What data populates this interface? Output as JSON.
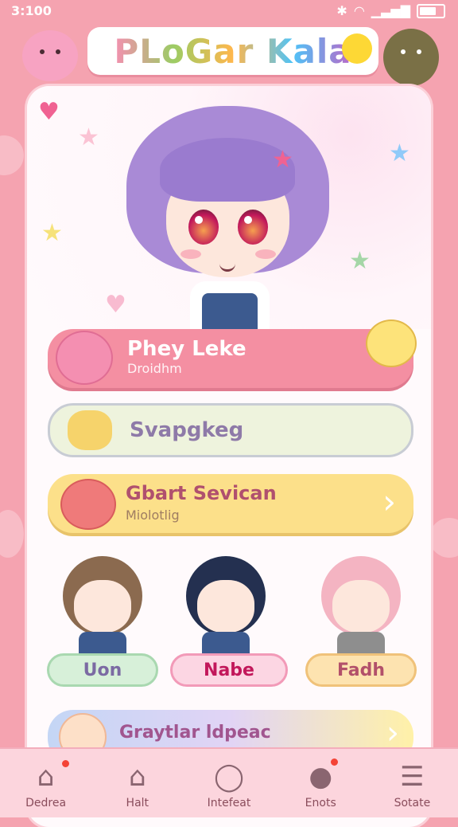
{
  "status_bar": {
    "time": "3:100"
  },
  "header": {
    "title": "PLoGar Kala"
  },
  "profile_row": {
    "title": "Phey Leke",
    "subtitle": "Droidhm"
  },
  "search_row": {
    "label": "Svapgkeg"
  },
  "start_row": {
    "title": "Gbart Sevican",
    "subtitle": "Miolotlig",
    "arrow": "›"
  },
  "characters": [
    {
      "name": "Uon"
    },
    {
      "name": "Nabe"
    },
    {
      "name": "Fadh"
    }
  ],
  "gallery_row": {
    "label": "Graytlar ldpeac",
    "arrow": "›"
  },
  "tabbar": {
    "items": [
      {
        "label": "Dedrea",
        "icon": "home-icon"
      },
      {
        "label": "Halt",
        "icon": "house-search-icon"
      },
      {
        "label": "Intefeat",
        "icon": "chat-bubble-icon"
      },
      {
        "label": "Enots",
        "icon": "creature-icon"
      },
      {
        "label": "Sotate",
        "icon": "menu-icon"
      }
    ]
  },
  "colors": {
    "background": "#f5a3b0",
    "profile": "#f48fa2",
    "start": "#fce08a",
    "search": "#eef3dd"
  }
}
